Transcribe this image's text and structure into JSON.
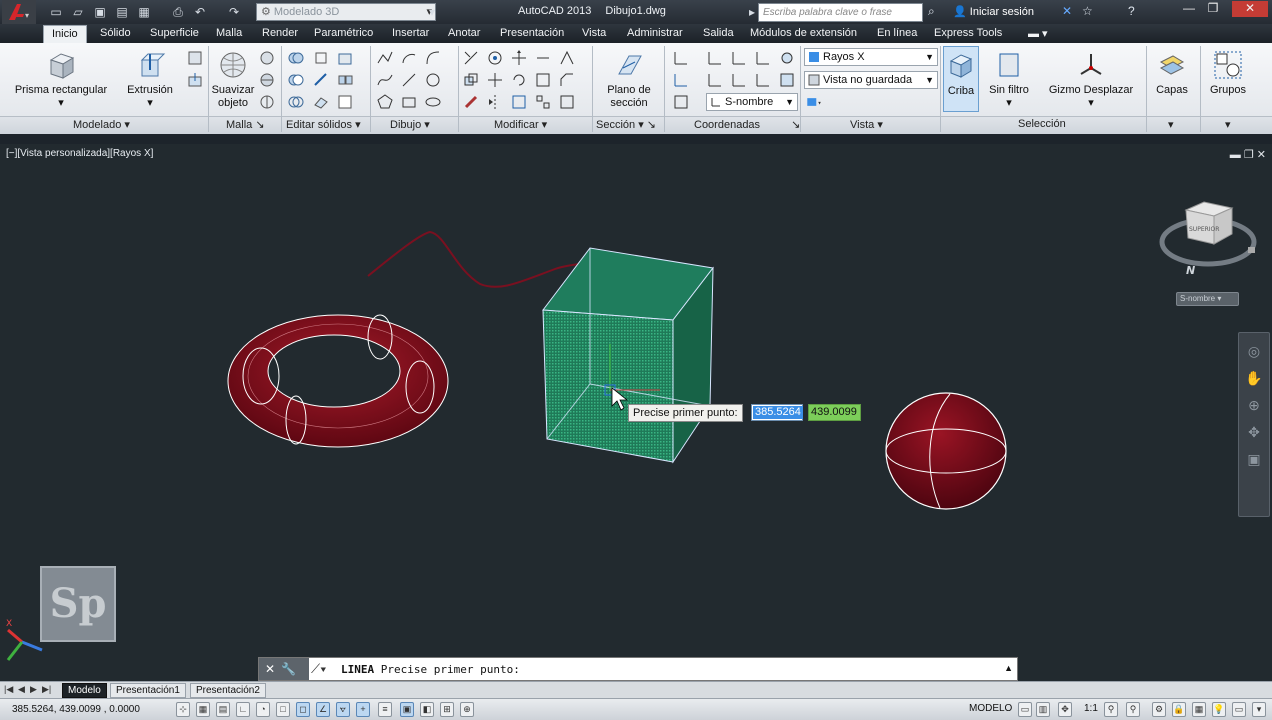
{
  "window": {
    "workspace": "Modelado 3D",
    "app_title": "AutoCAD 2013",
    "file_name": "Dibujo1.dwg",
    "search_placeholder": "Escriba palabra clave o frase",
    "signin": "Iniciar sesión"
  },
  "tabs": [
    "Inicio",
    "Sólido",
    "Superficie",
    "Malla",
    "Render",
    "Paramétrico",
    "Insertar",
    "Anotar",
    "Presentación",
    "Vista",
    "Administrar",
    "Salida",
    "Módulos de extensión",
    "En línea",
    "Express Tools"
  ],
  "ribbon": {
    "buttons": {
      "prisma": "Prisma rectangular",
      "extrusion": "Extrusión",
      "suavizar": "Suavizar objeto",
      "plano": "Plano de sección",
      "criba": "Criba",
      "sinfiltro": "Sin filtro",
      "gizmo": "Gizmo Desplazar",
      "capas": "Capas",
      "grupos": "Grupos"
    },
    "combos": {
      "visual_style": "Rayos X",
      "view": "Vista no guardada",
      "ucs": "S-nombre"
    },
    "panels": [
      "Modelado",
      "Malla",
      "Editar sólidos",
      "Dibujo",
      "Modificar",
      "Sección",
      "Coordenadas",
      "Vista",
      "Selección"
    ]
  },
  "viewport": {
    "label": "[−][Vista personalizada][Rayos X]",
    "viewcube_face": "SUPERIOR",
    "compass_north": "N",
    "ucs_badge": "S-nombre",
    "watermark": "Sp",
    "tooltip": "Precise primer punto:",
    "input_x": "385.5264",
    "input_y": "439.0099",
    "colors": {
      "background": "#222a2f",
      "torus": "#8a0f1c",
      "box": "#2aa877",
      "sphere": "#7d0c18",
      "polyline": "#8a1220"
    }
  },
  "command": {
    "keyword": "LINEA",
    "prompt": "Precise primer punto:"
  },
  "layout_tabs": [
    "Modelo",
    "Presentación1",
    "Presentación2"
  ],
  "status": {
    "coordinates": "385.5264,  439.0099 , 0.0000",
    "model_label": "MODELO",
    "annotation_scale": "1:1"
  }
}
